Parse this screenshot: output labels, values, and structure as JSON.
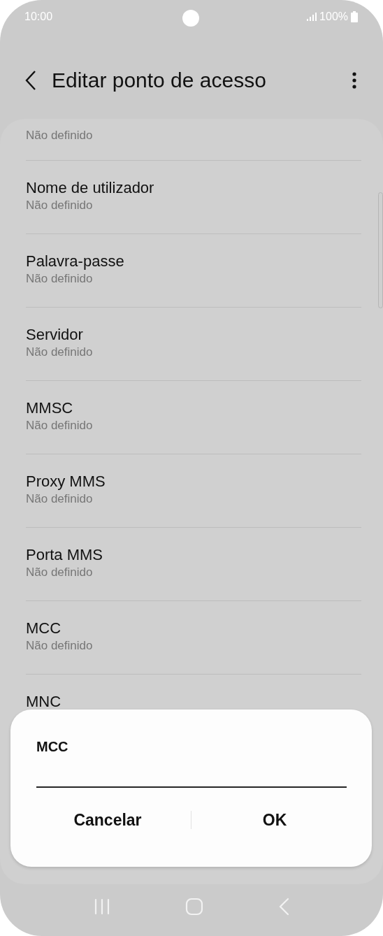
{
  "status_bar": {
    "time": "10:00",
    "battery": "100%"
  },
  "header": {
    "title": "Editar ponto de acesso"
  },
  "settings": [
    {
      "value": "Não definido"
    },
    {
      "title": "Nome de utilizador",
      "value": "Não definido"
    },
    {
      "title": "Palavra-passe",
      "value": "Não definido"
    },
    {
      "title": "Servidor",
      "value": "Não definido"
    },
    {
      "title": "MMSC",
      "value": "Não definido"
    },
    {
      "title": "Proxy MMS",
      "value": "Não definido"
    },
    {
      "title": "Porta MMS",
      "value": "Não definido"
    },
    {
      "title": "MCC",
      "value": "Não definido"
    },
    {
      "title": "MNC"
    }
  ],
  "dialog": {
    "title": "MCC",
    "buttons": [
      "Cancelar",
      "OK"
    ]
  }
}
